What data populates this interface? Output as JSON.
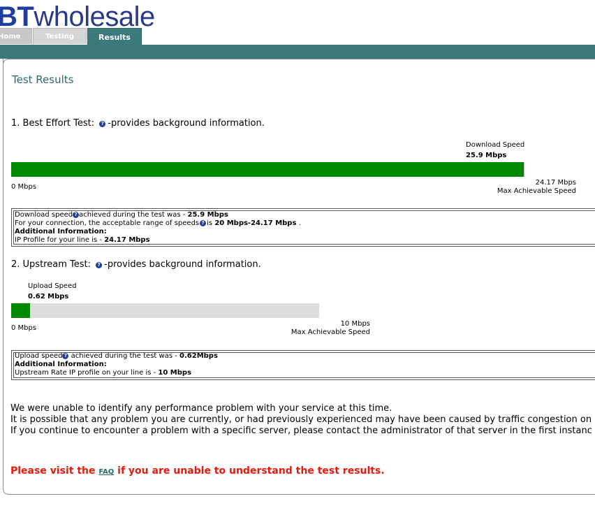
{
  "header": {
    "logo_prefix": "BT",
    "logo_text": "wholesale",
    "tabs": [
      {
        "label": "Home"
      },
      {
        "label": "Testing"
      },
      {
        "label": "Results"
      }
    ]
  },
  "title": "Test Results",
  "best_effort": {
    "heading": "1. Best Effort Test:",
    "heading_suffix": "-provides background information.",
    "bar_label": "Download Speed",
    "bar_value": "25.9 Mbps",
    "axis_min": "0 Mbps",
    "axis_max_value": "24.17 Mbps",
    "axis_max_label": "Max Achievable Speed",
    "fill_fraction": 1.0,
    "info": {
      "line1_prefix": "Download speed",
      "line1_middle": "achieved during the test was - ",
      "line1_value": "25.9 Mbps",
      "line2_prefix": "For your connection, the acceptable range of speeds",
      "line2_middle": "is ",
      "line2_value": "20 Mbps-24.17 Mbps",
      "line2_suffix": " .",
      "line3": "Additional Information:",
      "line4_prefix": "IP Profile for your line is - ",
      "line4_value": "24.17 Mbps"
    }
  },
  "upstream": {
    "heading": "2. Upstream Test:",
    "heading_suffix": "-provides background information.",
    "bar_label": "Upload Speed",
    "bar_value": "0.62 Mbps",
    "axis_min": "0 Mbps",
    "axis_max_value": "10 Mbps",
    "axis_max_label": "Max Achievable Speed",
    "fill_fraction": 0.062,
    "info": {
      "line1_prefix": "Upload speed",
      "line1_middle": " achieved during the test was - ",
      "line1_value": "0.62Mbps",
      "line2": "Additional Information:",
      "line3_prefix": "Upstream Rate IP profile on your line is - ",
      "line3_value": "10 Mbps"
    }
  },
  "messages": [
    "We were unable to identify any performance problem with your service at this time.",
    "It is possible that any problem you are currently, or had previously experienced may have been caused by traffic congestion on",
    "If you continue to encounter a problem with a specific server, please contact the administrator of that server in the first instanc"
  ],
  "faq": {
    "prefix": "Please visit the ",
    "link": "FAQ",
    "suffix": " if you are unable to understand the test results."
  },
  "colors": {
    "teal": "#3d7979",
    "green_bar": "#008800",
    "alert_red": "#e8190d"
  },
  "icons": {
    "help": "question-circle-icon"
  }
}
